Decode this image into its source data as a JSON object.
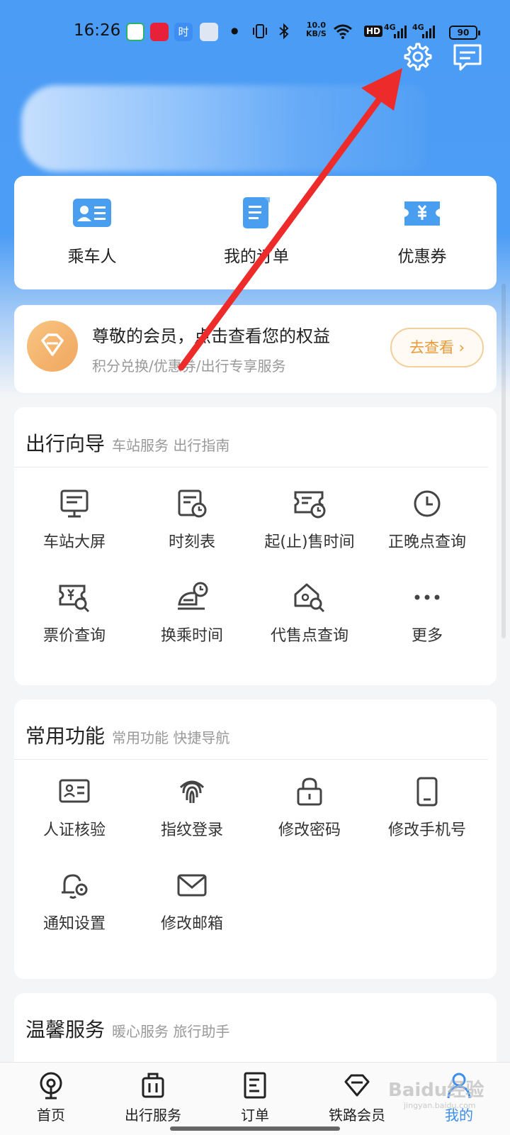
{
  "status_bar": {
    "time": "16:26",
    "speed_value": "10.0",
    "speed_unit": "KB/S",
    "hd": "HD",
    "net1": "4G",
    "net2": "4G",
    "battery": "90",
    "app_badge": "时"
  },
  "header": {
    "settings_icon": "gear-icon",
    "message_icon": "message-icon"
  },
  "quick_actions": [
    {
      "label": "乘车人",
      "icon": "id-card-icon"
    },
    {
      "label": "我的订单",
      "icon": "order-doc-icon"
    },
    {
      "label": "优惠券",
      "icon": "coupon-icon"
    }
  ],
  "member": {
    "title": "尊敬的会员，点击查看您的权益",
    "subtitle": "积分兑换/优惠券/出行专享服务",
    "button": "去查看 ›"
  },
  "travel_guide": {
    "title": "出行向导",
    "subtitle": "车站服务 出行指南",
    "items": [
      {
        "label": "车站大屏",
        "icon": "monitor-icon"
      },
      {
        "label": "时刻表",
        "icon": "timetable-icon"
      },
      {
        "label": "起(止)售时间",
        "icon": "ticket-clock-icon"
      },
      {
        "label": "正晚点查询",
        "icon": "clock-icon"
      },
      {
        "label": "票价查询",
        "icon": "price-search-icon"
      },
      {
        "label": "换乘时间",
        "icon": "transfer-train-icon"
      },
      {
        "label": "代售点查询",
        "icon": "agency-search-icon"
      },
      {
        "label": "更多",
        "icon": "more-icon"
      }
    ]
  },
  "common_functions": {
    "title": "常用功能",
    "subtitle": "常用功能 快捷导航",
    "items": [
      {
        "label": "人证核验",
        "icon": "id-verify-icon"
      },
      {
        "label": "指纹登录",
        "icon": "fingerprint-icon"
      },
      {
        "label": "修改密码",
        "icon": "lock-icon"
      },
      {
        "label": "修改手机号",
        "icon": "phone-icon"
      },
      {
        "label": "通知设置",
        "icon": "bell-gear-icon"
      },
      {
        "label": "修改邮箱",
        "icon": "mail-icon"
      }
    ]
  },
  "warm_service": {
    "title": "温馨服务",
    "subtitle": "暖心服务 旅行助手"
  },
  "bottom_nav": [
    {
      "label": "首页",
      "icon": "home-train-icon",
      "active": false
    },
    {
      "label": "出行服务",
      "icon": "luggage-icon",
      "active": false
    },
    {
      "label": "订单",
      "icon": "order-icon",
      "active": false
    },
    {
      "label": "铁路会员",
      "icon": "diamond-icon",
      "active": false
    },
    {
      "label": "我的",
      "icon": "user-icon",
      "active": true
    }
  ],
  "watermark": {
    "text": "Baidu经验",
    "sub": "jingyan.baidu.com"
  },
  "colors": {
    "primary": "#4b9cf5",
    "accent_orange": "#f0a65e",
    "active_blue": "#3b8df0",
    "arrow": "#ee2b2b"
  }
}
